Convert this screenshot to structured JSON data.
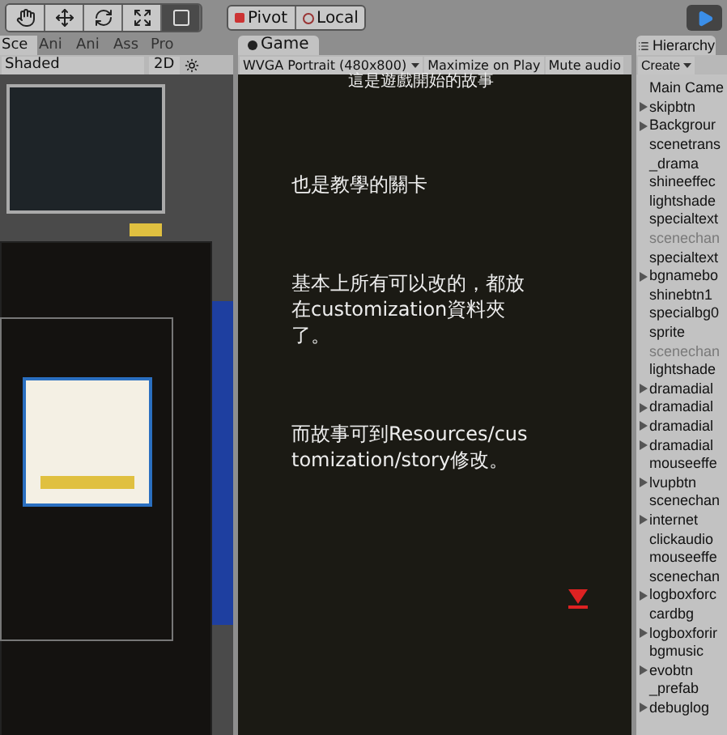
{
  "toolbar": {
    "tools": [
      {
        "kind": "hand",
        "selected": false
      },
      {
        "kind": "move",
        "selected": false
      },
      {
        "kind": "rotate",
        "selected": false
      },
      {
        "kind": "scale",
        "selected": false
      },
      {
        "kind": "rect",
        "selected": true
      }
    ],
    "pivot": "Pivot",
    "local": "Local",
    "play": {
      "on": true
    }
  },
  "scene_panel": {
    "tabs": [
      {
        "label": "Sce",
        "selected": true
      },
      {
        "label": "Ani",
        "selected": false
      },
      {
        "label": "Ani",
        "selected": false
      },
      {
        "label": "Ass",
        "selected": false
      },
      {
        "label": "Pro",
        "selected": false
      }
    ],
    "shading": "Shaded",
    "mode_2d": "2D"
  },
  "game_panel": {
    "tab": "Game",
    "resolution": "WVGA Portrait (480x800)",
    "maximize": "Maximize on Play",
    "mute": "Mute audio",
    "lines": [
      {
        "kind": "caption",
        "text": "這是遊戲開始的故事"
      },
      {
        "kind": "body",
        "text": "也是教學的關卡"
      },
      {
        "kind": "body",
        "text": "基本上所有可以改的，都放在customization資料夾了。"
      },
      {
        "kind": "body",
        "text": "而故事可到Resources/customization/story修改。"
      }
    ]
  },
  "hierarchy": {
    "title": "Hierarchy",
    "create": "Create",
    "items": [
      {
        "name": "Main Came",
        "expandable": false,
        "disabled": false
      },
      {
        "name": "skipbtn",
        "expandable": true,
        "disabled": false
      },
      {
        "name": "Backgrour",
        "expandable": true,
        "disabled": false
      },
      {
        "name": "scenetrans",
        "expandable": false,
        "disabled": false
      },
      {
        "name": "_drama",
        "expandable": false,
        "disabled": false
      },
      {
        "name": "shineeffec",
        "expandable": false,
        "disabled": false
      },
      {
        "name": "lightshade",
        "expandable": false,
        "disabled": false
      },
      {
        "name": "specialtext",
        "expandable": false,
        "disabled": false
      },
      {
        "name": "scenechan",
        "expandable": false,
        "disabled": true
      },
      {
        "name": "specialtext",
        "expandable": false,
        "disabled": false
      },
      {
        "name": "bgnamebo",
        "expandable": true,
        "disabled": false
      },
      {
        "name": "shinebtn1",
        "expandable": false,
        "disabled": false
      },
      {
        "name": "specialbg0",
        "expandable": false,
        "disabled": false
      },
      {
        "name": "sprite",
        "expandable": false,
        "disabled": false
      },
      {
        "name": "scenechan",
        "expandable": false,
        "disabled": true
      },
      {
        "name": "lightshade",
        "expandable": false,
        "disabled": false
      },
      {
        "name": "dramadial",
        "expandable": true,
        "disabled": false
      },
      {
        "name": "dramadial",
        "expandable": true,
        "disabled": false
      },
      {
        "name": "dramadial",
        "expandable": true,
        "disabled": false
      },
      {
        "name": "dramadial",
        "expandable": true,
        "disabled": false
      },
      {
        "name": "mouseeffe",
        "expandable": false,
        "disabled": false
      },
      {
        "name": "lvupbtn",
        "expandable": true,
        "disabled": false
      },
      {
        "name": "scenechan",
        "expandable": false,
        "disabled": false
      },
      {
        "name": "internet",
        "expandable": true,
        "disabled": false
      },
      {
        "name": "clickaudio",
        "expandable": false,
        "disabled": false
      },
      {
        "name": "mouseeffe",
        "expandable": false,
        "disabled": false
      },
      {
        "name": "scenechan",
        "expandable": false,
        "disabled": false
      },
      {
        "name": "logboxforc",
        "expandable": true,
        "disabled": false
      },
      {
        "name": "cardbg",
        "expandable": false,
        "disabled": false
      },
      {
        "name": "logboxforir",
        "expandable": true,
        "disabled": false
      },
      {
        "name": "bgmusic",
        "expandable": false,
        "disabled": false
      },
      {
        "name": "evobtn",
        "expandable": true,
        "disabled": false
      },
      {
        "name": "_prefab",
        "expandable": false,
        "disabled": false
      },
      {
        "name": "debuglog",
        "expandable": true,
        "disabled": false
      }
    ]
  }
}
